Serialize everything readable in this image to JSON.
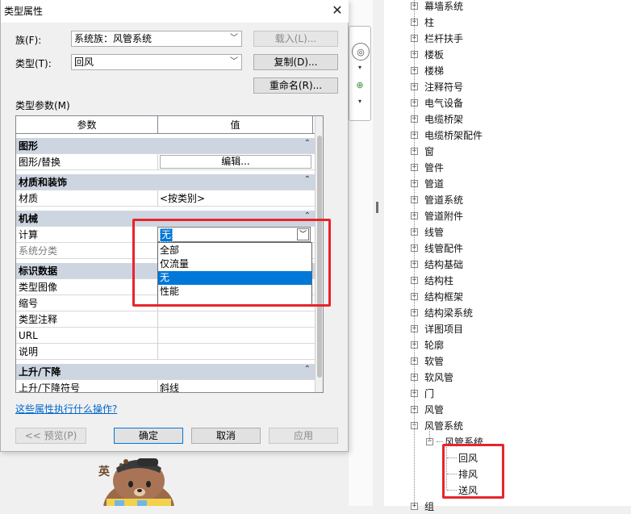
{
  "dialog": {
    "title": "类型属性",
    "family_label": "族(F):",
    "family_value": "系统族：风管系统",
    "load_button": "载入(L)...",
    "type_label": "类型(T):",
    "type_value": "回风",
    "duplicate_button": "复制(D)...",
    "rename_button": "重命名(R)...",
    "params_label": "类型参数(M)",
    "col_param": "参数",
    "col_value": "值",
    "col_extra": "=",
    "groups": {
      "graphics": "图形",
      "materials": "材质和装饰",
      "mechanical": "机械",
      "identity": "标识数据",
      "rise_drop": "上升/下降"
    },
    "rows": {
      "graphic_override": "图形/替换",
      "edit_button": "编辑...",
      "material": "材质",
      "material_value": "<按类别>",
      "calculation": "计算",
      "system_classification": "系统分类",
      "type_image": "类型图像",
      "type_mark": "缩号",
      "type_comments": "类型注释",
      "url": "URL",
      "description": "说明",
      "rise_drop_symbol": "上升/下降符号",
      "rise_drop_value": "斜线"
    },
    "calc_selected": "无",
    "calc_options": [
      "全部",
      "仅流量",
      "无",
      "性能"
    ],
    "help_link": "这些属性执行什么操作?",
    "preview_button": "<< 预览(P)",
    "ok_button": "确定",
    "cancel_button": "取消",
    "apply_button": "应用"
  },
  "tree": {
    "items": [
      "幕墙系统",
      "柱",
      "栏杆扶手",
      "楼板",
      "楼梯",
      "注释符号",
      "电气设备",
      "电缆桥架",
      "电缆桥架配件",
      "窗",
      "管件",
      "管道",
      "管道系统",
      "管道附件",
      "线管",
      "线管配件",
      "结构基础",
      "结构柱",
      "结构框架",
      "结构梁系统",
      "详图项目",
      "轮廓",
      "软管",
      "软风管",
      "门",
      "风管",
      "风管系统"
    ],
    "sub_folder": "风管系统",
    "leaves": [
      "回风",
      "排风",
      "送风"
    ],
    "partial": "组"
  },
  "mascot_text": "英",
  "colors": {
    "highlight_red": "#e8242b",
    "selection_blue": "#0078d7",
    "group_header": "#cdd5e1"
  }
}
